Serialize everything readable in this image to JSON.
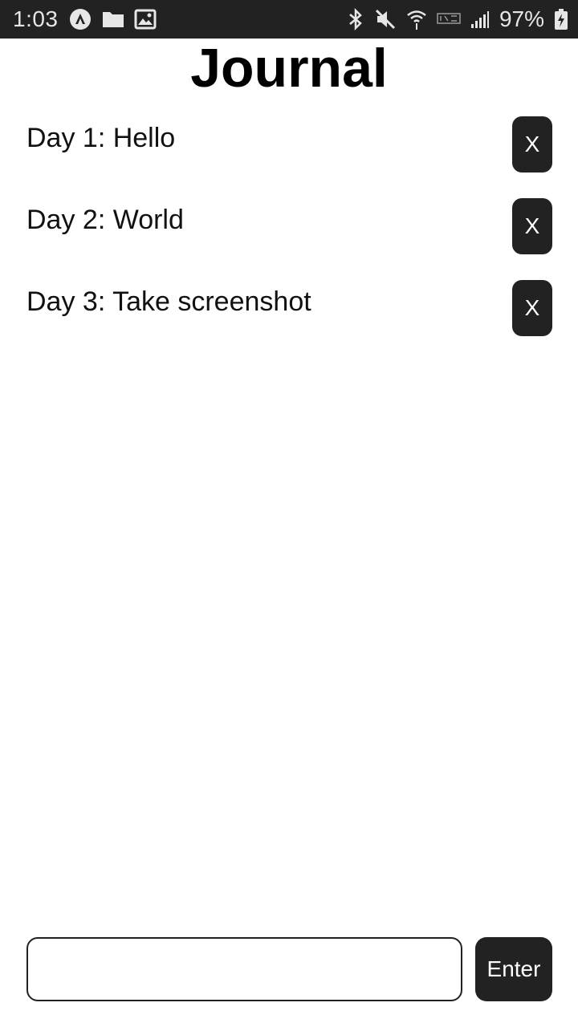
{
  "status_bar": {
    "time": "1:03",
    "battery_percent": "97%",
    "left_icons": [
      "app-notification-icon",
      "folder-icon",
      "image-icon"
    ],
    "right_icons": [
      "bluetooth-icon",
      "mute-icon",
      "wifi-icon",
      "volte-icon",
      "signal-icon",
      "battery-charging-icon"
    ]
  },
  "header": {
    "title": "Journal"
  },
  "entries": [
    {
      "text": "Day 1: Hello",
      "delete_label": "X"
    },
    {
      "text": "Day 2: World",
      "delete_label": "X"
    },
    {
      "text": "Day 3: Take screenshot",
      "delete_label": "X"
    }
  ],
  "composer": {
    "input_value": "",
    "input_placeholder": "",
    "enter_label": "Enter"
  },
  "colors": {
    "status_bar_bg": "#222222",
    "button_bg": "#222222",
    "button_text": "#ffffff",
    "page_bg": "#ffffff"
  }
}
